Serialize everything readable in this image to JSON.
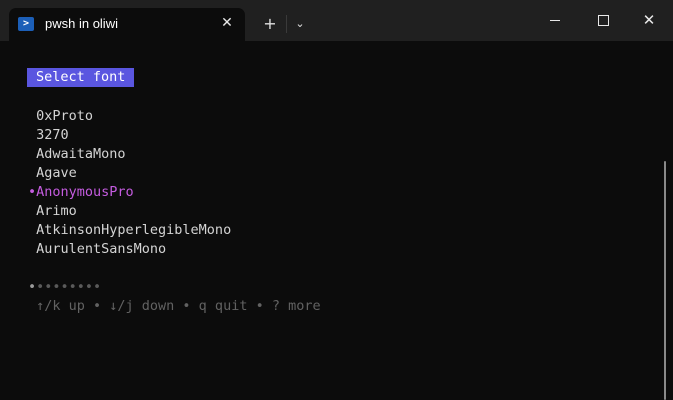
{
  "window": {
    "tab_title": "pwsh in oliwi",
    "tab_icon": "powershell-icon",
    "close_tab_glyph": "✕",
    "new_tab_glyph": "+",
    "dropdown_glyph": "⌄",
    "close_window_glyph": "✕"
  },
  "terminal": {
    "header": "Select font",
    "fonts": [
      {
        "label": " 0xProto"
      },
      {
        "label": " 3270"
      },
      {
        "label": " AdwaitaMono"
      },
      {
        "label": " Agave"
      },
      {
        "label": "•AnonymousPro",
        "selected": true
      },
      {
        "label": " Arimo"
      },
      {
        "label": " AtkinsonHyperlegibleMono"
      },
      {
        "label": " AurulentSansMono"
      }
    ],
    "pagination": {
      "active": "•",
      "rest": "••••••••"
    },
    "help": " ↑/k up • ↓/j down • q quit • ? more"
  },
  "colors": {
    "header_bg": "#5a56e0",
    "selected_fg": "#c55ce0",
    "background": "#0c0c0c",
    "titlebar": "#202020"
  }
}
